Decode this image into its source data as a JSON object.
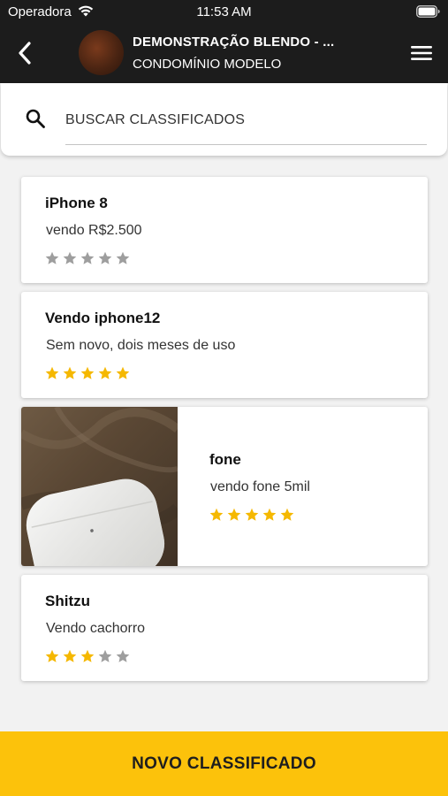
{
  "status_bar": {
    "carrier": "Operadora",
    "time": "11:53 AM"
  },
  "header": {
    "title": "DEMONSTRAÇÃO BLENDO - ...",
    "subtitle": "CONDOMÍNIO MODELO"
  },
  "search": {
    "placeholder": "BUSCAR CLASSIFICADOS"
  },
  "listings": [
    {
      "title": "iPhone 8",
      "description": "vendo R$2.500",
      "rating": 0,
      "max_rating": 5,
      "has_image": false
    },
    {
      "title": "Vendo iphone12",
      "description": "Sem novo, dois meses de uso",
      "rating": 5,
      "max_rating": 5,
      "has_image": false
    },
    {
      "title": "fone",
      "description": "vendo fone 5mil",
      "rating": 5,
      "max_rating": 5,
      "has_image": true
    },
    {
      "title": "Shitzu",
      "description": "Vendo cachorro",
      "rating": 3,
      "max_rating": 5,
      "has_image": false
    }
  ],
  "new_listing_button": {
    "label": "NOVO CLASSIFICADO"
  },
  "colors": {
    "header_bg": "#1c1c1c",
    "accent_yellow": "#fcc20b",
    "star_filled": "#f5b800",
    "star_empty": "#9e9e9e",
    "page_bg": "#f2f2f2"
  },
  "icons": {
    "back": "chevron-left-icon",
    "menu": "hamburger-menu-icon",
    "search": "search-icon",
    "star": "star-icon",
    "wifi": "wifi-icon",
    "battery": "battery-icon"
  }
}
